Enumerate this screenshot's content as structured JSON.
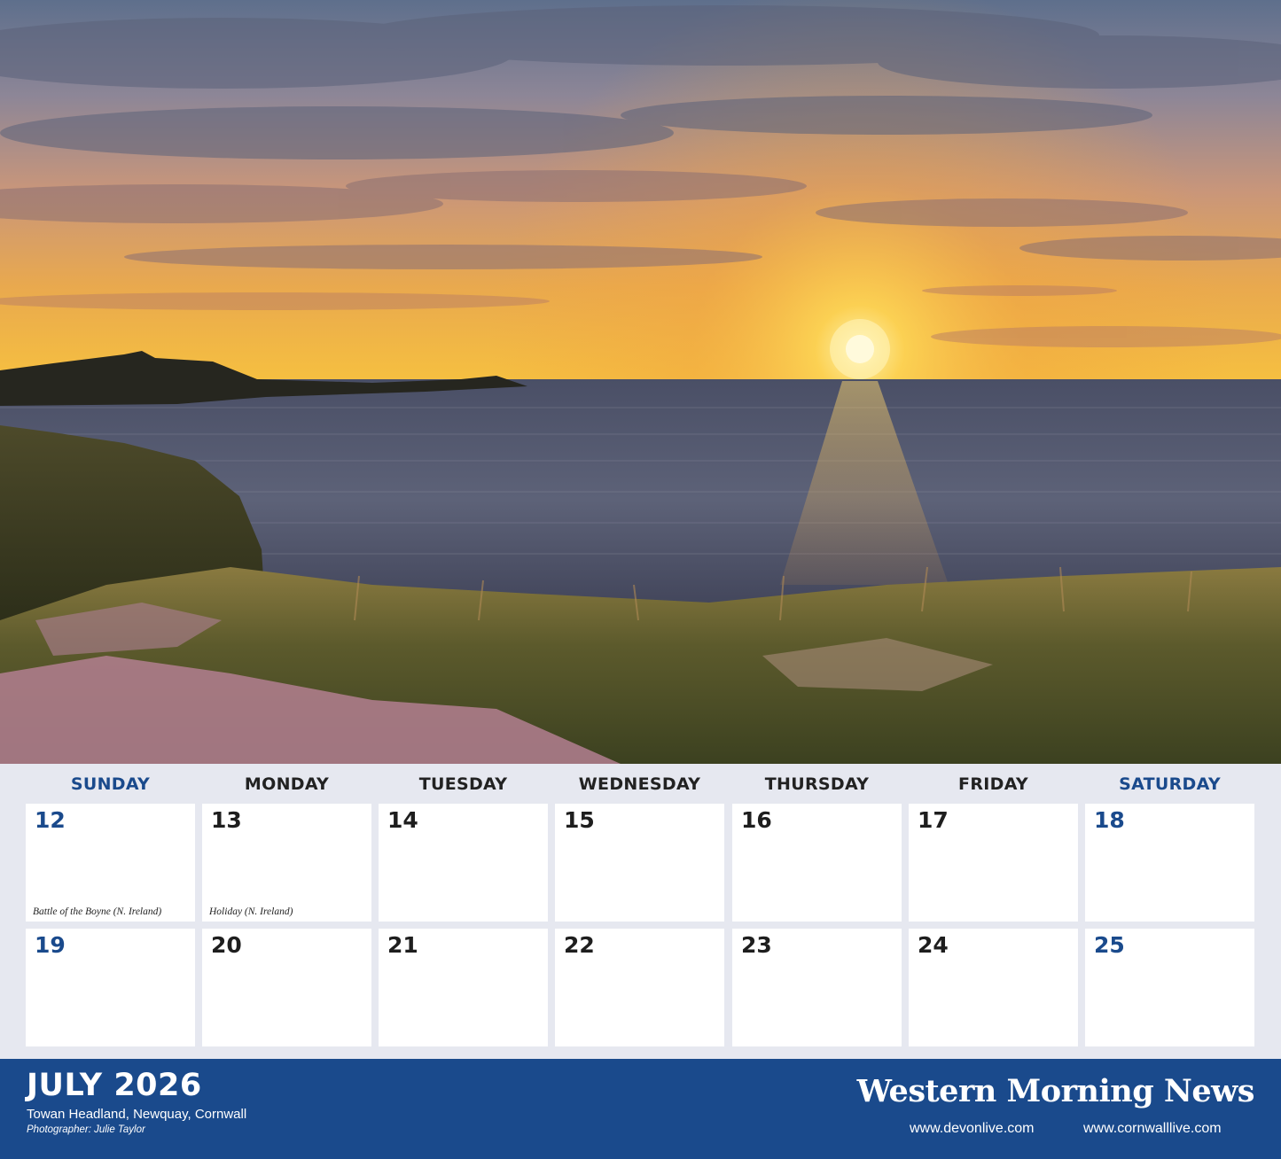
{
  "calendar": {
    "weekdays": [
      "SUNDAY",
      "MONDAY",
      "TUESDAY",
      "WEDNESDAY",
      "THURSDAY",
      "FRIDAY",
      "SATURDAY"
    ],
    "weeks": [
      [
        {
          "day": "12",
          "note": "Battle of the Boyne (N. Ireland)"
        },
        {
          "day": "13",
          "note": "Holiday (N. Ireland)"
        },
        {
          "day": "14",
          "note": ""
        },
        {
          "day": "15",
          "note": ""
        },
        {
          "day": "16",
          "note": ""
        },
        {
          "day": "17",
          "note": ""
        },
        {
          "day": "18",
          "note": ""
        }
      ],
      [
        {
          "day": "19",
          "note": ""
        },
        {
          "day": "20",
          "note": ""
        },
        {
          "day": "21",
          "note": ""
        },
        {
          "day": "22",
          "note": ""
        },
        {
          "day": "23",
          "note": ""
        },
        {
          "day": "24",
          "note": ""
        },
        {
          "day": "25",
          "note": ""
        }
      ]
    ]
  },
  "footer": {
    "month_title": "JULY 2026",
    "location": "Towan Headland, Newquay, Cornwall",
    "photographer": "Photographer: Julie Taylor",
    "brand": "Western Morning News",
    "url_devon": "www.devonlive.com",
    "url_cornwall": "www.cornwalllive.com"
  },
  "colors": {
    "accent_blue": "#1a4a8c",
    "grid_background": "#e6e8f0",
    "cell_background": "#ffffff"
  }
}
